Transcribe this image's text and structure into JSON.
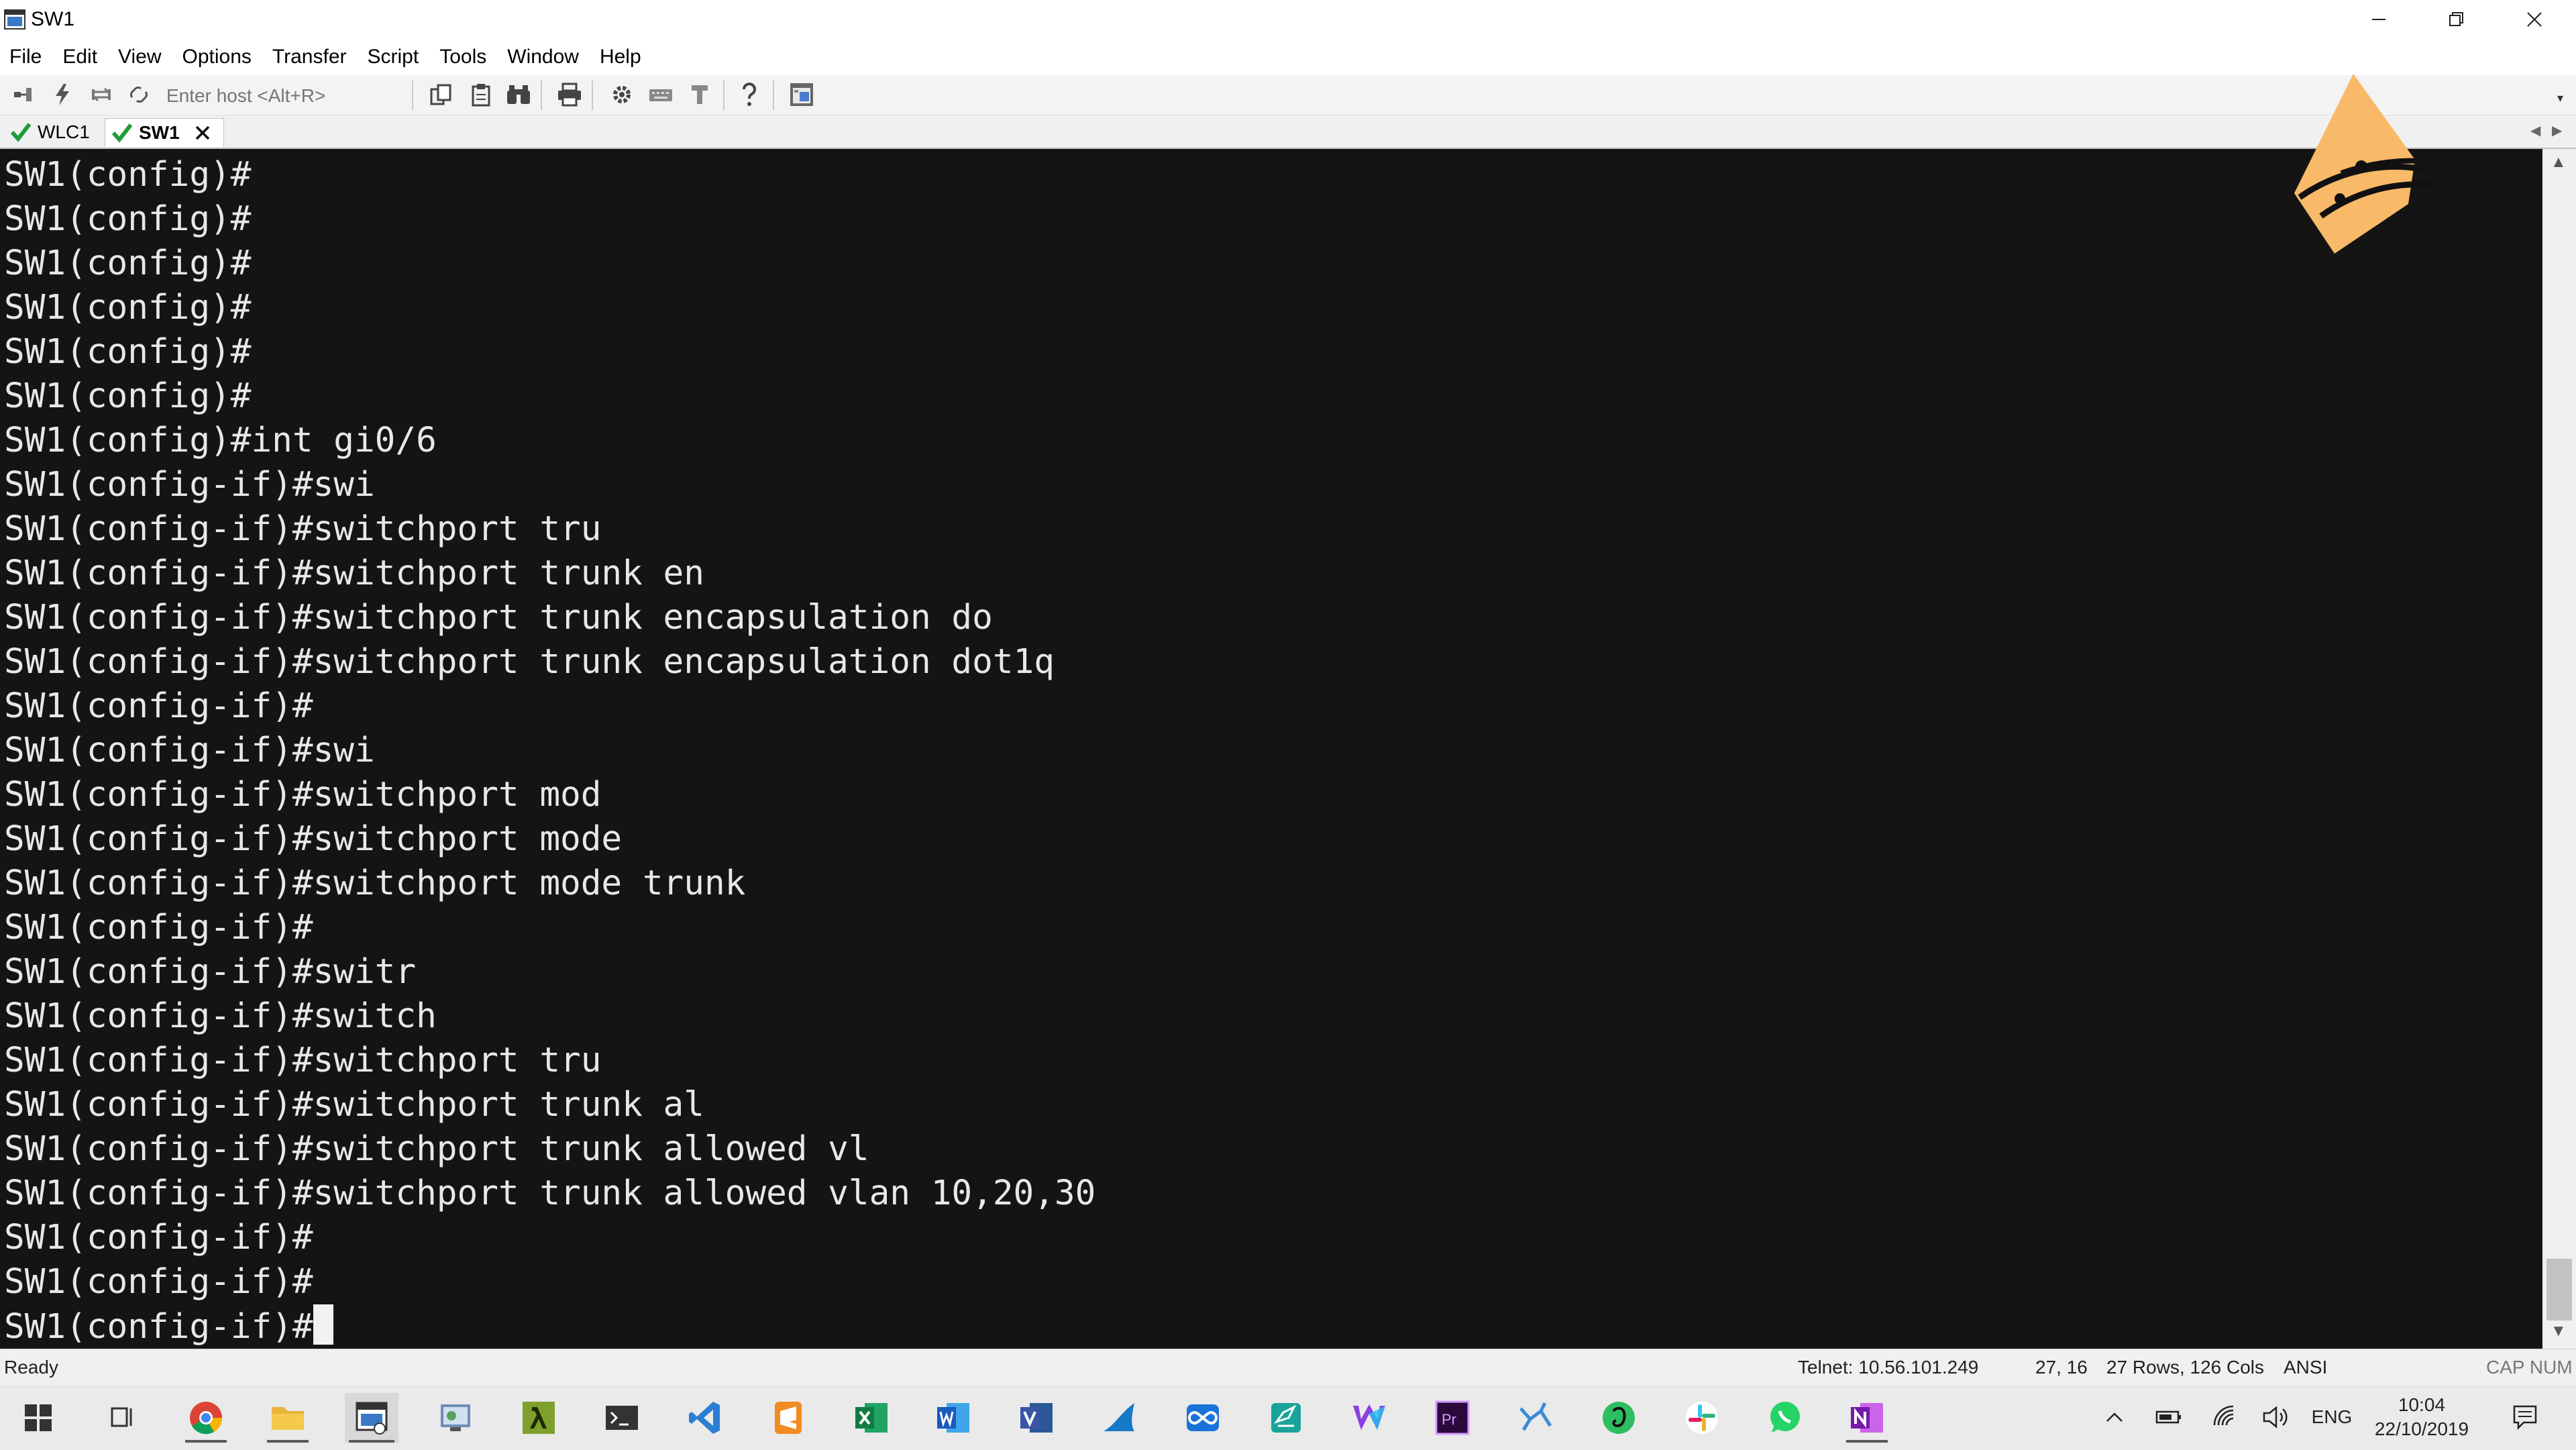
{
  "window": {
    "title": "SW1",
    "controls": [
      "minimize",
      "restore",
      "close"
    ]
  },
  "menu": [
    "File",
    "Edit",
    "View",
    "Options",
    "Transfer",
    "Script",
    "Tools",
    "Window",
    "Help"
  ],
  "toolbar": {
    "host_placeholder": "Enter host <Alt+R>",
    "icons": [
      "connect-icon",
      "quick-connect-icon",
      "reconnect-icon",
      "disconnect-icon",
      "copy-icon",
      "paste-icon",
      "find-icon",
      "print-icon",
      "settings-icon",
      "keymap-icon",
      "sftp-icon",
      "help-icon",
      "session-manager-icon"
    ]
  },
  "tabs": [
    {
      "label": "WLC1",
      "status": "connected"
    },
    {
      "label": "SW1",
      "status": "connected",
      "active": true
    }
  ],
  "terminal": {
    "lines": [
      "SW1(config)#",
      "SW1(config)#",
      "SW1(config)#",
      "SW1(config)#",
      "SW1(config)#",
      "SW1(config)#",
      "SW1(config)#int gi0/6",
      "SW1(config-if)#swi",
      "SW1(config-if)#switchport tru",
      "SW1(config-if)#switchport trunk en",
      "SW1(config-if)#switchport trunk encapsulation do",
      "SW1(config-if)#switchport trunk encapsulation dot1q",
      "SW1(config-if)#",
      "SW1(config-if)#swi",
      "SW1(config-if)#switchport mod",
      "SW1(config-if)#switchport mode",
      "SW1(config-if)#switchport mode trunk",
      "SW1(config-if)#",
      "SW1(config-if)#switr",
      "SW1(config-if)#switch",
      "SW1(config-if)#switchport tru",
      "SW1(config-if)#switchport trunk al",
      "SW1(config-if)#switchport trunk allowed vl",
      "SW1(config-if)#switchport trunk allowed vlan 10,20,30",
      "SW1(config-if)#",
      "SW1(config-if)#",
      "SW1(config-if)#"
    ]
  },
  "statusbar": {
    "state": "Ready",
    "connection": "Telnet: 10.56.101.249",
    "cursor_pos": "27,  16",
    "dimensions": "27 Rows, 126 Cols",
    "emulation": "ANSI",
    "keys": "CAP NUM"
  },
  "taskbar": {
    "apps": [
      "windows-start-icon",
      "task-view-icon",
      "chrome-icon",
      "file-explorer-icon",
      "securecrt-icon",
      "control-panel-icon",
      "lambda-app-icon",
      "terminal-app-icon",
      "vscode-icon",
      "sublime-text-icon",
      "excel-icon",
      "word-icon",
      "visio-icon",
      "wireshark-icon",
      "infinity-app-icon",
      "notes-app-icon",
      "webstorm-icon",
      "premiere-pro-icon",
      "network-app-icon",
      "evernote-icon",
      "slack-icon",
      "whatsapp-icon",
      "onenote-icon"
    ],
    "language": "ENG",
    "time": "10:04",
    "date": "22/10/2019"
  },
  "colors": {
    "terminal_bg": "#141414",
    "terminal_fg": "#e8e8e8",
    "tab_check": "#1f9d3a",
    "logo_orange": "#f8b968"
  }
}
